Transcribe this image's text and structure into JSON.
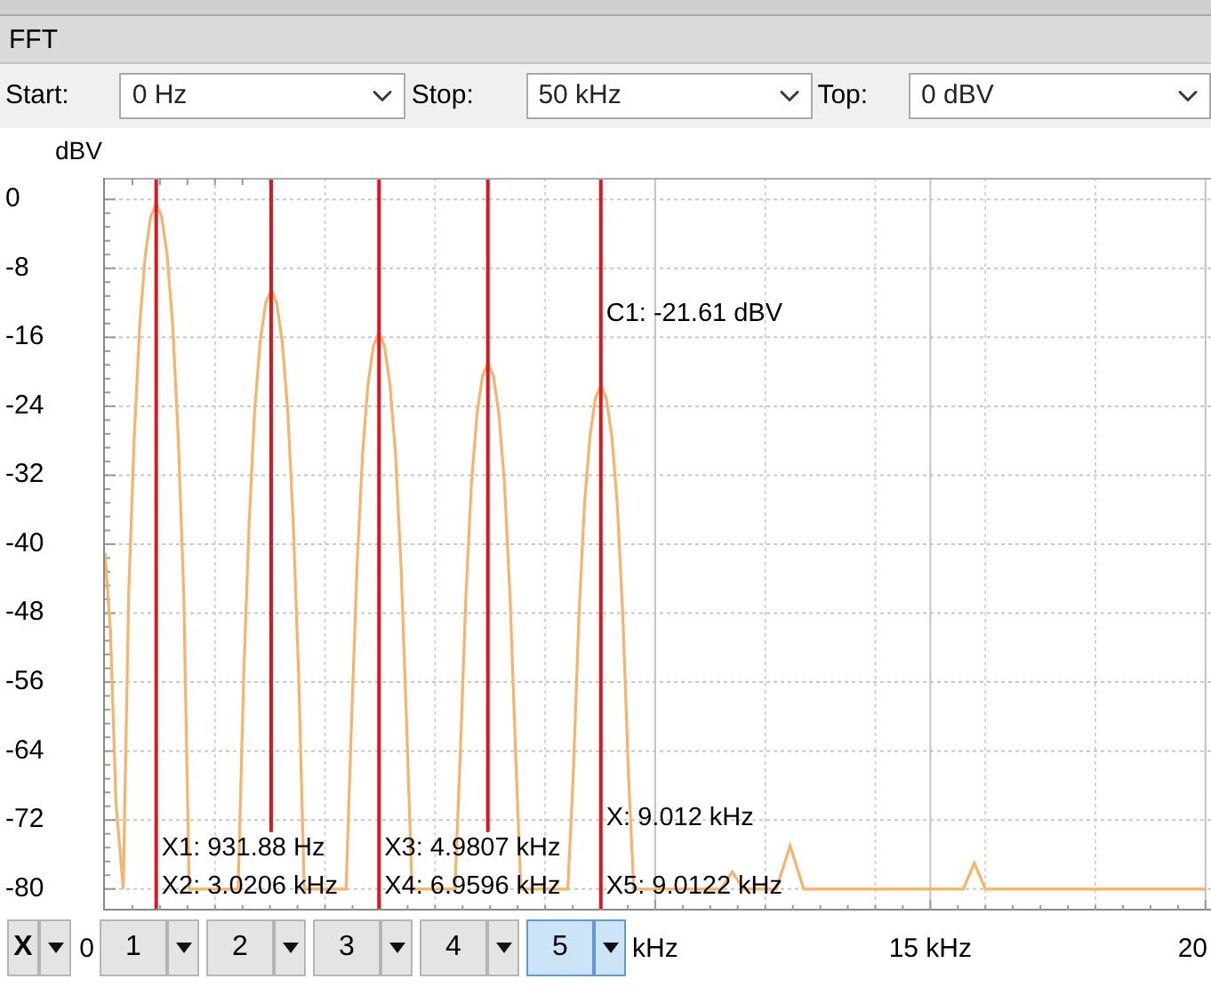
{
  "panel": {
    "title": "FFT"
  },
  "toolbar": [
    {
      "label": "Start:",
      "value": "0 Hz"
    },
    {
      "label": "Stop:",
      "value": "50 kHz"
    },
    {
      "label": "Top:",
      "value": "0 dBV"
    }
  ],
  "plot": {
    "chart_data": {
      "type": "line",
      "ylabel": "dBV",
      "xlim": [
        0,
        20.1
      ],
      "ylim": [
        -82.5,
        2.5
      ],
      "yticks": [
        0,
        -8,
        -16,
        -24,
        -32,
        -40,
        -48,
        -56,
        -64,
        -72,
        -80
      ],
      "xticks": [
        {
          "value": 0,
          "label": "0"
        },
        {
          "value": 10,
          "label": "kHz"
        },
        {
          "value": 15,
          "label": "15 kHz"
        },
        {
          "value": 20,
          "label": "20"
        }
      ],
      "x": [
        0,
        0.1,
        0.2,
        0.332,
        0.432,
        0.532,
        0.632,
        0.732,
        0.832,
        0.932,
        1.032,
        1.132,
        1.232,
        1.332,
        1.432,
        1.532,
        2.421,
        2.521,
        2.621,
        2.721,
        2.821,
        2.921,
        3.021,
        3.121,
        3.221,
        3.321,
        3.421,
        3.521,
        3.621,
        4.381,
        4.481,
        4.581,
        4.681,
        4.781,
        4.881,
        4.981,
        5.081,
        5.181,
        5.281,
        5.381,
        5.481,
        5.581,
        6.36,
        6.46,
        6.56,
        6.66,
        6.76,
        6.86,
        6.96,
        7.06,
        7.16,
        7.26,
        7.36,
        7.46,
        7.56,
        8.412,
        8.512,
        8.612,
        8.712,
        8.812,
        8.912,
        9.012,
        9.112,
        9.212,
        9.312,
        9.412,
        9.512,
        9.612,
        11.2,
        11.4,
        11.6,
        12.2,
        12.45,
        12.7,
        15.6,
        15.8,
        16,
        20
      ],
      "series": [
        {
          "color": "#f7b36a",
          "values": [
            -41,
            -50,
            -70,
            -80,
            -45.5,
            -27.5,
            -14.5,
            -6.5,
            -2,
            -0.5,
            -2,
            -6.5,
            -14.5,
            -27.5,
            -45.5,
            -80,
            -80,
            -55.5,
            -37.5,
            -24.5,
            -16.5,
            -12,
            -10.5,
            -12,
            -16.5,
            -24.5,
            -37.5,
            -55.5,
            -80,
            -80,
            -60.5,
            -42.5,
            -29.5,
            -21.5,
            -17,
            -15.5,
            -17,
            -21.5,
            -29.5,
            -42.5,
            -60.5,
            -80,
            -80,
            -64,
            -46,
            -33,
            -25,
            -20.5,
            -19,
            -20.5,
            -25,
            -33,
            -46,
            -64,
            -80,
            -80,
            -66.6,
            -48.6,
            -35.6,
            -27.6,
            -23.1,
            -21.6,
            -23.1,
            -27.6,
            -35.6,
            -48.6,
            -66.6,
            -80,
            -80,
            -78,
            -80,
            -80,
            -75,
            -80,
            -80,
            -77,
            -80,
            -80
          ]
        }
      ],
      "grid": true,
      "ref_lines": [
        {
          "axis": "x",
          "value": 0.93188,
          "color": "#e0141c"
        },
        {
          "axis": "x",
          "value": 3.0206,
          "color": "#e0141c"
        },
        {
          "axis": "x",
          "value": 4.9807,
          "color": "#e0141c"
        },
        {
          "axis": "x",
          "value": 6.9596,
          "color": "#e0141c"
        },
        {
          "axis": "x",
          "value": 9.0122,
          "color": "#e0141c"
        }
      ],
      "annotations": [
        "X1: 931.88 Hz",
        "X2: 3.0206 kHz",
        "X3: 4.9807 kHz",
        "X4: 6.9596 kHz",
        "X: 9.012 kHz",
        "X5: 9.0122 kHz",
        "C1: -21.61 dBV"
      ]
    }
  },
  "marker_bar": {
    "axis_button": "X",
    "buttons": [
      {
        "label": "1",
        "selected": false
      },
      {
        "label": "2",
        "selected": false
      },
      {
        "label": "3",
        "selected": false
      },
      {
        "label": "4",
        "selected": false
      },
      {
        "label": "5",
        "selected": true
      }
    ]
  }
}
